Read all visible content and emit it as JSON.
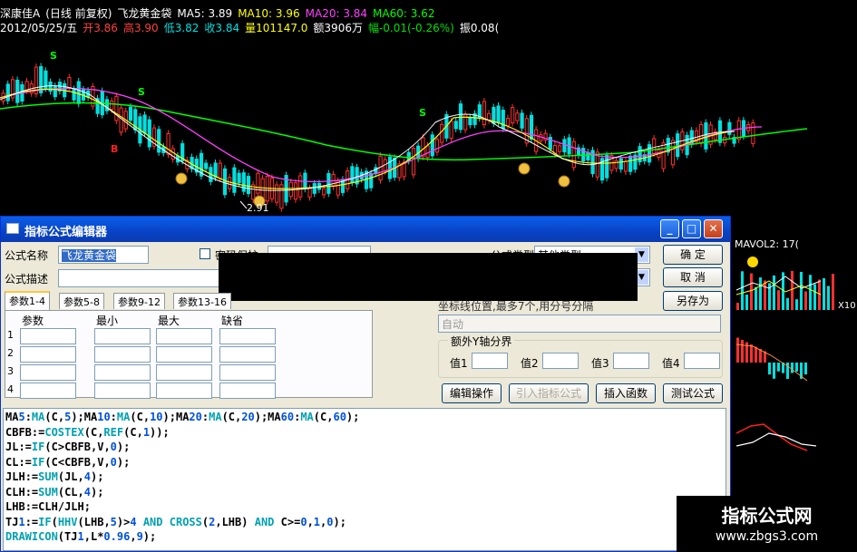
{
  "chart_header": {
    "line1": [
      {
        "text": "深康佳A",
        "color": "#ffffff"
      },
      {
        "text": "(日线 前复权)",
        "color": "#ffffff"
      },
      {
        "text": "飞龙黄金袋",
        "color": "#ffffff"
      },
      {
        "text": "MA5: 3.89",
        "color": "#ffffff"
      },
      {
        "text": "MA10: 3.96",
        "color": "#ffff00"
      },
      {
        "text": "MA20: 3.84",
        "color": "#ff40ff"
      },
      {
        "text": "MA60: 3.62",
        "color": "#00ff00"
      }
    ],
    "line2": [
      {
        "text": "2012/05/25/五",
        "color": "#ffffff"
      },
      {
        "text": "开3.86",
        "color": "#ff4040"
      },
      {
        "text": "高3.90",
        "color": "#ff4040"
      },
      {
        "text": "低3.82",
        "color": "#00e0e0"
      },
      {
        "text": "收3.84",
        "color": "#00e0e0"
      },
      {
        "text": "量101147.0",
        "color": "#ffff00"
      },
      {
        "text": "额3906万",
        "color": "#ffffff"
      },
      {
        "text": "幅-0.01(-0.26%)",
        "color": "#00e000"
      },
      {
        "text": "振0.08(",
        "color": "#ffffff"
      }
    ],
    "low_label": "2.91",
    "signal_s": "S",
    "signal_b": "B"
  },
  "sub_chart": {
    "label": "MAVOL2: 17(",
    "side_label": "X10"
  },
  "watermark": {
    "title": "指标公式网",
    "url": "www.zbgs3.com"
  },
  "dialog": {
    "title": "指标公式编辑器",
    "name_label": "公式名称",
    "name_value": "飞龙黄金袋",
    "desc_label": "公式描述",
    "password_label": "密码保护",
    "type_label": "公式类型",
    "type_value": "其他类型",
    "ok_button": "确  定",
    "cancel_button": "取  消",
    "save_as_button": "另存为",
    "tabs": [
      "参数1-4",
      "参数5-8",
      "参数9-12",
      "参数13-16"
    ],
    "param_headers": [
      "参数",
      "最小",
      "最大",
      "缺省"
    ],
    "param_rows": [
      "1",
      "2",
      "3",
      "4"
    ],
    "axis_label": "坐标线位置,最多7个,用分号分隔",
    "axis_value": "自动",
    "extra_axis_group": "额外Y轴分界",
    "axis_values": [
      "值1",
      "值2",
      "值3",
      "值4"
    ],
    "edit_button": "编辑操作",
    "import_button": "引入指标公式",
    "insert_button": "插入函数",
    "test_button": "测试公式"
  },
  "code_lines": [
    "MA5:MA(C,5);MA10:MA(C,10);MA20:MA(C,20);MA60:MA(C,60);",
    "CBFB:=COSTEX(C,REF(C,1));",
    "JL:=IF(C>CBFB,V,0);",
    "CL:=IF(C<CBFB,V,0);",
    "JLH:=SUM(JL,4);",
    "CLH:=SUM(CL,4);",
    "LHB:=CLH/JLH;",
    "TJ1:=IF(HHV(LHB,5)>4 AND CROSS(2,LHB) AND C>=0,1,0);",
    "DRAWICON(TJ1,L*0.96,9);"
  ],
  "colors": {
    "up": "#ff3030",
    "down": "#00e0e0",
    "ma5": "#ffffff",
    "ma10": "#ffff00",
    "ma20": "#ff40ff",
    "ma60": "#00ff00"
  }
}
